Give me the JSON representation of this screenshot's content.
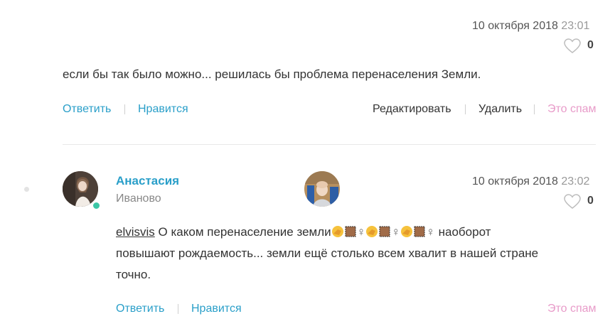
{
  "comment1": {
    "date": "10 октября 2018",
    "time": "23:01",
    "likes": "0",
    "text": "если бы так было можно... решилась бы проблема перенаселения Земли.",
    "actions": {
      "reply": "Ответить",
      "like": "Нравится",
      "edit": "Редактировать",
      "delete": "Удалить",
      "spam": "Это спам"
    }
  },
  "comment2": {
    "author": "Анастасия",
    "city": "Иваново",
    "date": "10 октября 2018",
    "time": "23:02",
    "likes": "0",
    "mention": "elvisvis",
    "text_part1": "О каком перенаселение земли",
    "text_part2": "наоборот",
    "text_line2": "повышают рождаемость... земли ещё столько всем хвалит в нашей стране",
    "text_line3": "точно.",
    "female_sign": "♀",
    "actions": {
      "reply": "Ответить",
      "like": "Нравится",
      "spam": "Это спам"
    }
  },
  "colors": {
    "accent": "#2a9fc9",
    "spam": "#e89bc9",
    "online": "#3cc7a6"
  }
}
